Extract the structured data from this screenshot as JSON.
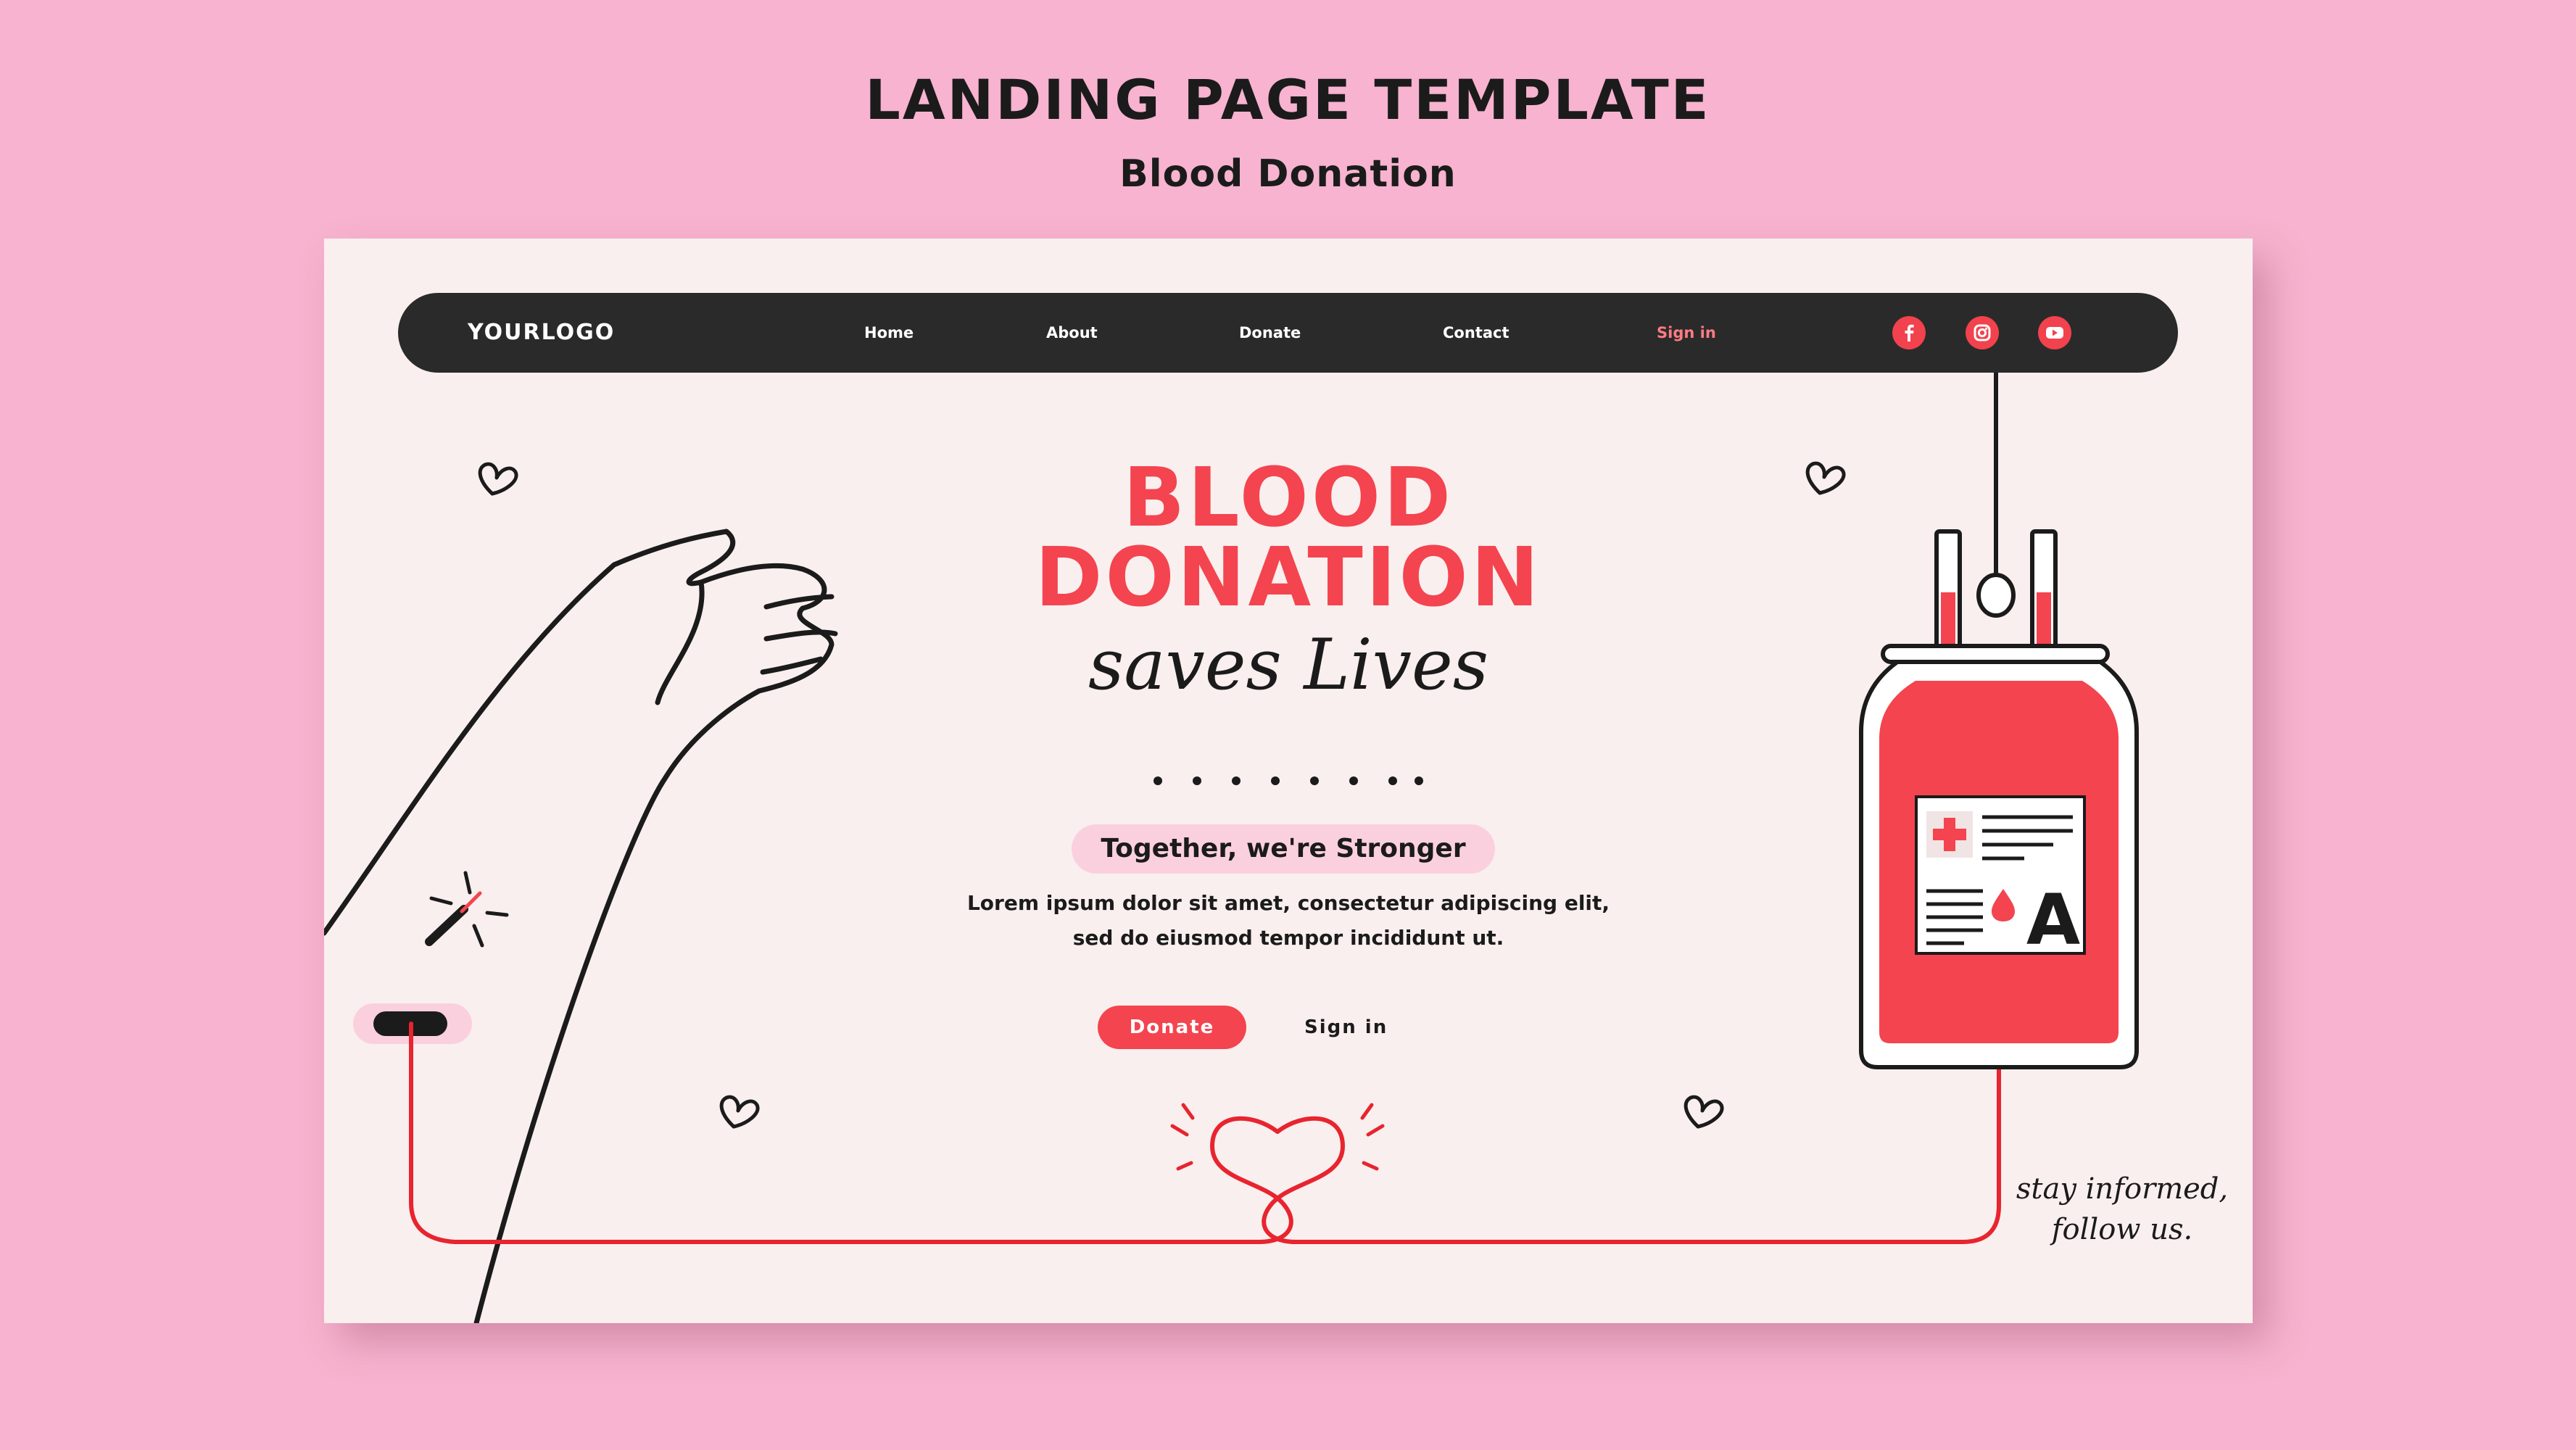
{
  "header": {
    "title": "LANDING PAGE TEMPLATE",
    "subtitle": "Blood Donation"
  },
  "navbar": {
    "logo": "YOURLOGO",
    "links": [
      "Home",
      "About",
      "Donate",
      "Contact"
    ],
    "signin_label": "Sign in",
    "social": [
      {
        "name": "facebook-icon",
        "color": "#f2424d"
      },
      {
        "name": "instagram-icon",
        "color": "#f2424d"
      },
      {
        "name": "youtube-icon",
        "color": "#f2424d"
      }
    ]
  },
  "hero": {
    "line1": "BLOOD",
    "line2": "DONATION",
    "script": "saves Lives",
    "tagline": "Together, we're Stronger",
    "body": "Lorem ipsum dolor sit amet, consectetur adipiscing elit, sed do eiusmod tempor incididunt ut.",
    "donate_label": "Donate",
    "signin_label": "Sign in"
  },
  "blood_bag": {
    "blood_type": "A"
  },
  "footer_note": {
    "line1": "stay informed,",
    "line2": "follow us."
  },
  "colors": {
    "background": "#f7b3cf",
    "card": "#f9efee",
    "accent_red": "#f4444f",
    "navbar": "#2a2a2a",
    "pill": "#fbd0de"
  }
}
